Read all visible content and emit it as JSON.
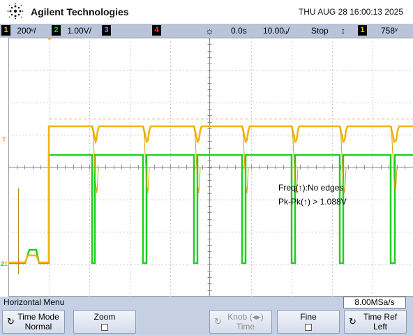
{
  "header": {
    "brand": "Agilent Technologies",
    "datetime": "THU AUG 28 16:00:13 2025"
  },
  "status": {
    "ch1": {
      "num": "1",
      "scale": "200ᵛ/",
      "color": "#f5c400"
    },
    "ch2": {
      "num": "2",
      "scale": "1.00V/",
      "color": "#23cf23"
    },
    "ch3": {
      "num": "3",
      "color": "#5aa0ff"
    },
    "ch4": {
      "num": "4",
      "color": "#ff3a4a"
    },
    "delay": "0.0s",
    "timebase": "10.00ᵤ/",
    "run_state": "Stop",
    "trig_src": "1",
    "trig_level": "758ᵛ"
  },
  "measurements": {
    "freq": "Freq(↑):No edges",
    "pkpk": "Pk-Pk(↑) > 1.088V"
  },
  "markers": {
    "ch1": "T",
    "ch2": "2",
    "ch1_ground": "1"
  },
  "menu": {
    "title": "Horizontal Menu",
    "sample_rate": "8.00MSa/s",
    "keys": [
      {
        "l1": "Time Mode",
        "l2": "Normal"
      },
      {
        "l1": "Zoom"
      },
      {
        "l1": "Knob (◂▸)",
        "l2": "Time"
      },
      {
        "l1": "Fine"
      },
      {
        "l1": "Time Ref",
        "l2": "Left"
      }
    ]
  },
  "colors": {
    "ch1": "#f0b400",
    "ch2": "#1fcf1f",
    "grid": "#9a9a9a"
  }
}
